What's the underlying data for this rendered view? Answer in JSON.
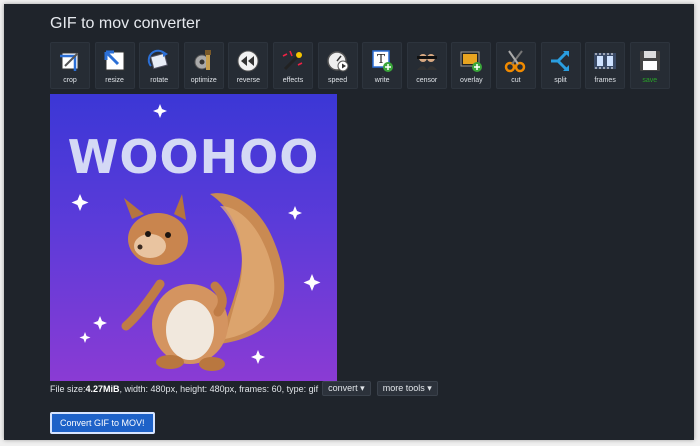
{
  "window": {
    "title": "GIF to mov converter"
  },
  "toolbar": {
    "tools": [
      {
        "label": "crop",
        "icon": "crop-icon"
      },
      {
        "label": "resize",
        "icon": "resize-icon"
      },
      {
        "label": "rotate",
        "icon": "rotate-icon"
      },
      {
        "label": "optimize",
        "icon": "optimize-icon"
      },
      {
        "label": "reverse",
        "icon": "reverse-icon"
      },
      {
        "label": "effects",
        "icon": "effects-icon"
      },
      {
        "label": "speed",
        "icon": "speed-icon"
      },
      {
        "label": "write",
        "icon": "write-icon"
      },
      {
        "label": "censor",
        "icon": "censor-icon"
      },
      {
        "label": "overlay",
        "icon": "overlay-icon"
      },
      {
        "label": "cut",
        "icon": "cut-icon"
      },
      {
        "label": "split",
        "icon": "split-icon"
      },
      {
        "label": "frames",
        "icon": "frames-icon"
      },
      {
        "label": "save",
        "icon": "save-icon"
      }
    ]
  },
  "preview": {
    "text": "WOOHOO"
  },
  "file_info": {
    "prefix": "File size: ",
    "size": "4.27MiB",
    "details": ", width: 480px, height: 480px, frames: 60, type: gif"
  },
  "dropdowns": {
    "convert": "convert ▾",
    "more_tools": "more tools ▾"
  },
  "convert_button": {
    "label": "Convert GIF to MOV!"
  },
  "colors": {
    "background": "#1f242b",
    "accent": "#1e62c8",
    "save": "#29a329"
  }
}
